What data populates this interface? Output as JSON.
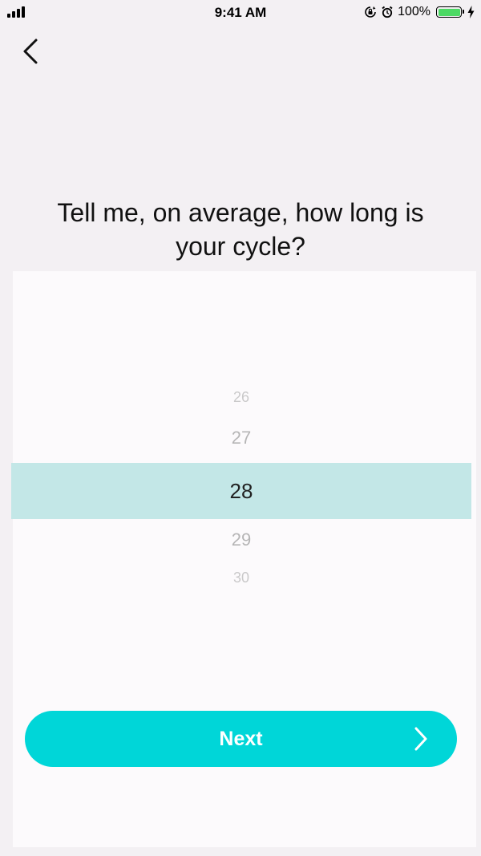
{
  "status_bar": {
    "time": "9:41 AM",
    "battery_percent": "100%",
    "battery_level": 1.0,
    "icons": [
      "signal-icon",
      "rotation-lock-icon",
      "alarm-icon",
      "battery-icon",
      "charging-icon"
    ]
  },
  "nav": {
    "back_icon": "chevron-left-icon"
  },
  "question": {
    "text": "Tell me, on average, how long is your cycle?"
  },
  "picker": {
    "above": [
      "26",
      "27"
    ],
    "selected": "28",
    "below": [
      "29",
      "30"
    ]
  },
  "next_button": {
    "label": "Next",
    "icon": "chevron-right-icon"
  },
  "colors": {
    "accent": "#00d6d8",
    "selection": "#c3e7e7",
    "background": "#f3f0f3"
  }
}
